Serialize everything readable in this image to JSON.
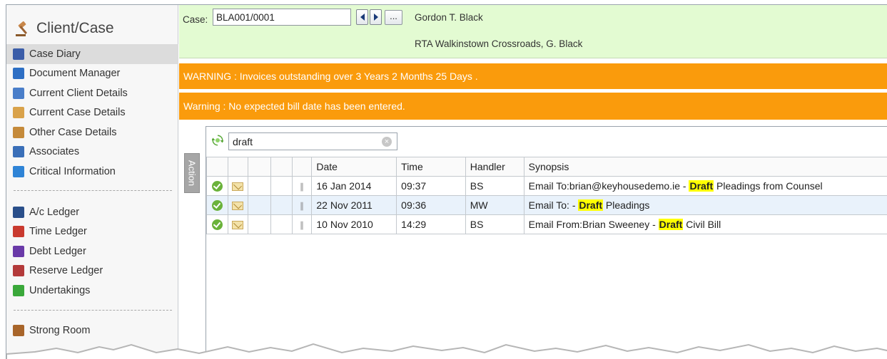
{
  "sidebar": {
    "title": "Client/Case",
    "group1": [
      {
        "label": "Case Diary",
        "icon": "case-diary-icon",
        "color": "#3b5da8"
      },
      {
        "label": "Document Manager",
        "icon": "document-manager-icon",
        "color": "#2e6fc4"
      },
      {
        "label": "Current Client Details",
        "icon": "client-details-icon",
        "color": "#4a7ec9"
      },
      {
        "label": "Current Case Details",
        "icon": "case-details-icon",
        "color": "#d9a24a"
      },
      {
        "label": "Other Case Details",
        "icon": "other-case-icon",
        "color": "#c58a3a"
      },
      {
        "label": "Associates",
        "icon": "associates-icon",
        "color": "#3a6fb8"
      },
      {
        "label": "Critical Information",
        "icon": "info-icon",
        "color": "#2f84d6"
      }
    ],
    "group2": [
      {
        "label": "A/c Ledger",
        "icon": "ac-ledger-icon",
        "color": "#2a4f8a"
      },
      {
        "label": "Time Ledger",
        "icon": "time-ledger-icon",
        "color": "#c93a2f"
      },
      {
        "label": "Debt Ledger",
        "icon": "debt-ledger-icon",
        "color": "#6a3aa8"
      },
      {
        "label": "Reserve Ledger",
        "icon": "reserve-ledger-icon",
        "color": "#b33a3a"
      },
      {
        "label": "Undertakings",
        "icon": "undertakings-icon",
        "color": "#3aa83a"
      }
    ],
    "group3": [
      {
        "label": "Strong Room",
        "icon": "strong-room-icon",
        "color": "#a8652a"
      }
    ]
  },
  "header": {
    "case_label": "Case:",
    "case_value": "BLA001/0001",
    "more_label": "...",
    "client_name": "Gordon T. Black",
    "case_description": "RTA Walkinstown Crossroads, G. Black"
  },
  "warnings": [
    "WARNING : Invoices outstanding over 3 Years 2 Months 25 Days .",
    "Warning : No expected bill date has been entered."
  ],
  "action_tab": "Action",
  "search": {
    "value": "draft"
  },
  "grid": {
    "columns": [
      "",
      "",
      "",
      "",
      "",
      "Date",
      "Time",
      "Handler",
      "Synopsis"
    ],
    "highlight_term": "Draft",
    "rows": [
      {
        "date": "16 Jan 2014",
        "time": "09:37",
        "handler": "BS",
        "synopsis_pre": "Email To:brian@keyhousedemo.ie - ",
        "synopsis_hl": "Draft",
        "synopsis_post": " Pleadings from Counsel",
        "selected": false
      },
      {
        "date": "22 Nov 2011",
        "time": "09:36",
        "handler": "MW",
        "synopsis_pre": "Email To: - ",
        "synopsis_hl": "Draft",
        "synopsis_post": " Pleadings",
        "selected": true
      },
      {
        "date": "10 Nov 2010",
        "time": "14:29",
        "handler": "BS",
        "synopsis_pre": "Email From:Brian Sweeney - ",
        "synopsis_hl": "Draft",
        "synopsis_post": " Civil Bill",
        "selected": false
      }
    ]
  },
  "colors": {
    "header_bg": "#e3fbd2",
    "warning_bg": "#fa9b0c",
    "highlight": "#ffff00",
    "selected_row": "#e9f2fb"
  }
}
